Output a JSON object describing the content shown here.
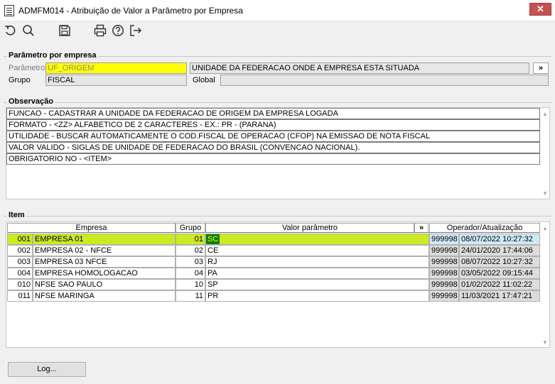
{
  "window": {
    "title": "ADMFM014 - Atribuição de Valor a Parâmetro por Empresa",
    "close_label": "✕"
  },
  "toolbar": {
    "icons": [
      "undo-icon",
      "search-icon",
      "save-icon",
      "print-icon",
      "help-icon",
      "exit-icon"
    ]
  },
  "parametro_section": {
    "legend": "Parâmetro por empresa",
    "parametro_label": "Parâmetro",
    "parametro_value": "UF_ORIGEM",
    "descricao_value": "UNIDADE DA FEDERACAO ONDE A EMPRESA  ESTA SITUADA",
    "expand_label": "»",
    "grupo_label": "Grupo",
    "grupo_value": "FISCAL",
    "global_label": "Global",
    "global_value": ""
  },
  "observacao_section": {
    "legend": "Observação",
    "lines": [
      "FUNCAO - CADASTRAR A UNIDADE DA FEDERACAO DE ORIGEM DA EMPRESA LOGADA",
      "FORMATO -  <ZZ> ALFABETICO DE 2 CARACTERES - EX.: PR - (PARANA)",
      "UTILIDADE -  BUSCAR AUTOMATICAMENTE O COD.FISCAL DE OPERACAO (CFOP)  NA EMISSAO DE NOTA FISCAL",
      "VALOR VALIDO - SIGLAS DE UNIDADE DE FEDERACAO DO BRASIL (CONVENCAO NACIONAL).",
      "OBRIGATORIO NO - <ITEM>"
    ]
  },
  "item_section": {
    "legend": "Item",
    "columns": {
      "empresa": "Empresa",
      "grupo": "Grupo",
      "valor": "Valor parâmetro",
      "expand": "»",
      "operador": "Operador/Atualização"
    },
    "rows": [
      {
        "code": "001",
        "empresa": "EMPRESA 01",
        "grupo": "01",
        "valor": "SC",
        "operador": "999998",
        "data": "08/07/2022 10:27:32"
      },
      {
        "code": "002",
        "empresa": "EMPRESA 02 - NFCE",
        "grupo": "02",
        "valor": "CE",
        "operador": "999998",
        "data": "24/01/2020 17:44:06"
      },
      {
        "code": "003",
        "empresa": "EMPRESA 03 NFCE",
        "grupo": "03",
        "valor": "RJ",
        "operador": "999998",
        "data": "08/07/2022 10:27:32"
      },
      {
        "code": "004",
        "empresa": "EMPRESA HOMOLOGACAO",
        "grupo": "04",
        "valor": "PA",
        "operador": "999998",
        "data": "03/05/2022 09:15:44"
      },
      {
        "code": "010",
        "empresa": "NFSE SAO PAULO",
        "grupo": "10",
        "valor": "SP",
        "operador": "999998",
        "data": "01/02/2022 11:02:22"
      },
      {
        "code": "011",
        "empresa": "NFSE MARINGA",
        "grupo": "11",
        "valor": "PR",
        "operador": "999998",
        "data": "11/03/2021 17:47:21"
      }
    ]
  },
  "footer": {
    "log_button": "Log..."
  },
  "colors": {
    "selected_row": "#ccea22",
    "highlight_field": "#ffff00",
    "selected_value_cell": "#008000"
  }
}
